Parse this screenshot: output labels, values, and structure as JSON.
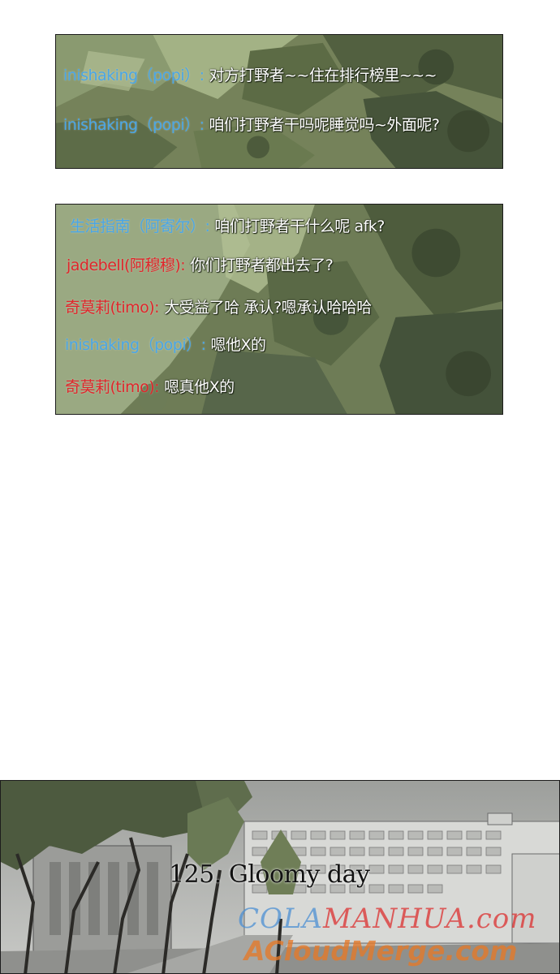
{
  "colors": {
    "speaker_blue": "#4aa6e6",
    "speaker_red": "#e0262b",
    "message_text": "#ffffff"
  },
  "chat_panel_1": {
    "lines": [
      {
        "speaker": "inishaking（popi）:",
        "speaker_color": "blue",
        "message": "对方打野者~~住在排行榜里~~~"
      },
      {
        "speaker": "inishaking（popi）:",
        "speaker_color": "blue",
        "message": "咱们打野者干吗呢睡觉吗~外面呢?"
      }
    ]
  },
  "chat_panel_2": {
    "lines": [
      {
        "speaker": "生活指南（阿寄尔）:",
        "speaker_color": "blue",
        "message": "咱们打野者干什么呢 afk?"
      },
      {
        "speaker": "jadebell(阿穆穆):",
        "speaker_color": "red",
        "message": "你们打野者都出去了?"
      },
      {
        "speaker": "奇莫莉(timo):",
        "speaker_color": "red",
        "message": "大受益了哈 承认?嗯承认哈哈哈"
      },
      {
        "speaker": "inishaking（popi）:",
        "speaker_color": "blue",
        "message": "嗯他X的"
      },
      {
        "speaker": "奇莫莉(timo):",
        "speaker_color": "red",
        "message": "嗯真他X的"
      }
    ]
  },
  "scene_panel": {
    "episode_title": "125. Gloomy day",
    "watermark_part_a": "COLA",
    "watermark_part_b": "MANHUA.com",
    "watermark_line_2": "ACloudMerge.com"
  }
}
